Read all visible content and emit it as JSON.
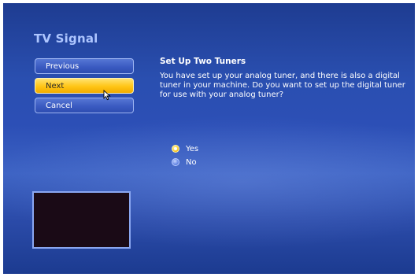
{
  "page": {
    "title": "TV Signal"
  },
  "nav": {
    "previous_label": "Previous",
    "next_label": "Next",
    "cancel_label": "Cancel"
  },
  "content": {
    "heading": "Set Up Two Tuners",
    "description": "You have set up your analog tuner, and there is also a digital tuner in your machine. Do you want to set up the digital tuner for use with your analog tuner?"
  },
  "options": [
    {
      "label": "Yes",
      "selected": true
    },
    {
      "label": "No",
      "selected": false
    }
  ],
  "colors": {
    "background": "#2a4fb0",
    "focus_button": "#ffc515",
    "title": "#aec6ff"
  }
}
